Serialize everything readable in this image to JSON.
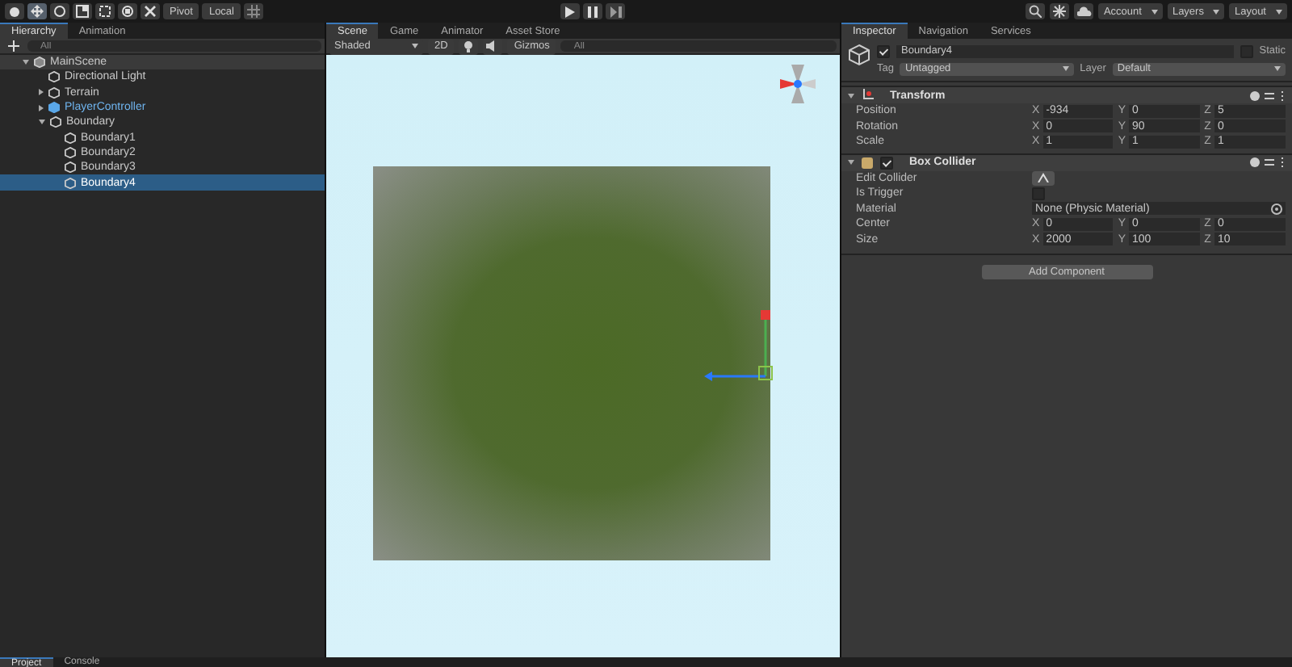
{
  "toolbar": {
    "tools": [
      {
        "kind": "hand",
        "selected": false
      },
      {
        "kind": "move",
        "selected": true
      },
      {
        "kind": "rotate",
        "selected": false
      },
      {
        "kind": "scale",
        "selected": false
      },
      {
        "kind": "rect",
        "selected": false
      },
      {
        "kind": "transform",
        "selected": false
      },
      {
        "kind": "custom",
        "selected": false
      }
    ],
    "pivot": "Pivot",
    "local": "Local",
    "right_buttons": [
      "Account",
      "Layers",
      "Layout"
    ]
  },
  "hierarchy": {
    "tabs": [
      {
        "label": "Hierarchy",
        "selected": true
      },
      {
        "label": "Animation",
        "selected": false
      }
    ],
    "search": {
      "placeholder": "All"
    },
    "tree": [
      {
        "label": "MainScene",
        "kind": "scene",
        "selected": false,
        "expanded": true,
        "children": [
          {
            "label": "Directional Light",
            "kind": "object",
            "selected": false
          },
          {
            "label": "Terrain",
            "kind": "object",
            "selected": false,
            "expanded": false
          },
          {
            "label": "PlayerController",
            "kind": "prefab",
            "selected": false,
            "expanded": false
          },
          {
            "label": "Boundary",
            "kind": "object",
            "selected": false,
            "expanded": true,
            "children": [
              {
                "label": "Boundary1",
                "kind": "object",
                "selected": false
              },
              {
                "label": "Boundary2",
                "kind": "object",
                "selected": false
              },
              {
                "label": "Boundary3",
                "kind": "object",
                "selected": false
              },
              {
                "label": "Boundary4",
                "kind": "object",
                "selected": true
              }
            ]
          }
        ]
      }
    ]
  },
  "scene": {
    "tabs": [
      {
        "label": "Scene",
        "selected": true
      },
      {
        "label": "Game",
        "selected": false
      },
      {
        "label": "Animator",
        "selected": false
      },
      {
        "label": "Asset Store",
        "selected": false
      }
    ],
    "shading": "Shaded",
    "mode_2d": "2D",
    "gizmos": "Gizmos",
    "search": {
      "placeholder": "All"
    }
  },
  "inspector": {
    "tabs": [
      {
        "label": "Inspector",
        "selected": true
      },
      {
        "label": "Navigation",
        "selected": false
      },
      {
        "label": "Services",
        "selected": false
      }
    ],
    "object": {
      "name": "Boundary4",
      "active": true,
      "static_label": "Static",
      "static": false,
      "tag_label": "Tag",
      "tag": "Untagged",
      "layer_label": "Layer",
      "layer": "Default"
    },
    "components": [
      {
        "title": "Transform",
        "kind": "transform",
        "rows": [
          {
            "label": "Position",
            "kind": "vector",
            "values": [
              {
                "axis": "X",
                "value": "-934"
              },
              {
                "axis": "Y",
                "value": "0"
              },
              {
                "axis": "Z",
                "value": "5"
              }
            ]
          },
          {
            "label": "Rotation",
            "kind": "vector",
            "values": [
              {
                "axis": "X",
                "value": "0"
              },
              {
                "axis": "Y",
                "value": "90"
              },
              {
                "axis": "Z",
                "value": "0"
              }
            ]
          },
          {
            "label": "Scale",
            "kind": "vector",
            "values": [
              {
                "axis": "X",
                "value": "1"
              },
              {
                "axis": "Y",
                "value": "1"
              },
              {
                "axis": "Z",
                "value": "1"
              }
            ]
          }
        ]
      },
      {
        "title": "Box Collider",
        "kind": "collider",
        "enabled": true,
        "rows": [
          {
            "label": "Edit Collider",
            "kind": "edit"
          },
          {
            "label": "Is Trigger",
            "kind": "toggle",
            "checked": false
          },
          {
            "label": "Material",
            "kind": "object",
            "value": "None (Physic Material)"
          },
          {
            "label": "Center",
            "kind": "vector",
            "values": [
              {
                "axis": "X",
                "value": "0"
              },
              {
                "axis": "Y",
                "value": "0"
              },
              {
                "axis": "Z",
                "value": "0"
              }
            ]
          },
          {
            "label": "Size",
            "kind": "vector",
            "values": [
              {
                "axis": "X",
                "value": "2000"
              },
              {
                "axis": "Y",
                "value": "100"
              },
              {
                "axis": "Z",
                "value": "10"
              }
            ]
          }
        ]
      }
    ],
    "add_component": "Add Component"
  },
  "bottom_tabs": [
    {
      "label": "Project",
      "selected": true
    },
    {
      "label": "Console",
      "selected": false
    }
  ]
}
